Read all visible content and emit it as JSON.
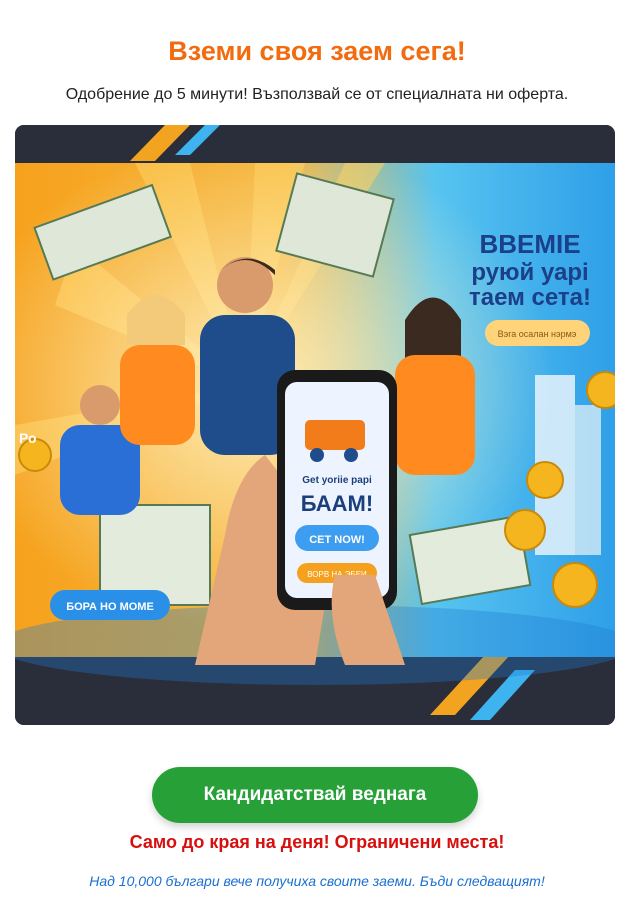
{
  "header": {
    "title": "Вземи своя заем сега!",
    "subtitle": "Одобрение до 5 минути! Възползвай се от специалната ни оферта."
  },
  "banner": {
    "headline_lines": [
      "BBEMIE",
      "руюй уарі",
      "таем сета!"
    ],
    "headline_button": "Вэга осалан нэрмэ",
    "phone_text_small": "Get yoriie papi",
    "phone_text_big": "БААМ!",
    "phone_button": "CET NOW!",
    "phone_button2": "ВОРВ НА ЭБЕИ",
    "left_button": "БОРА НО МОМЕ",
    "left_edge_text": "Ро"
  },
  "cta": {
    "label": "Кандидатствай веднага"
  },
  "urgency": {
    "text": "Само до края на деня! Ограничени места!"
  },
  "social_proof": {
    "text": "Над 10,000 българи вече получиха своите заеми. Бъди следващият!"
  },
  "colors": {
    "title": "#f26b0f",
    "cta": "#27a137",
    "urgency": "#d80f0f",
    "social": "#1a6fd0"
  }
}
